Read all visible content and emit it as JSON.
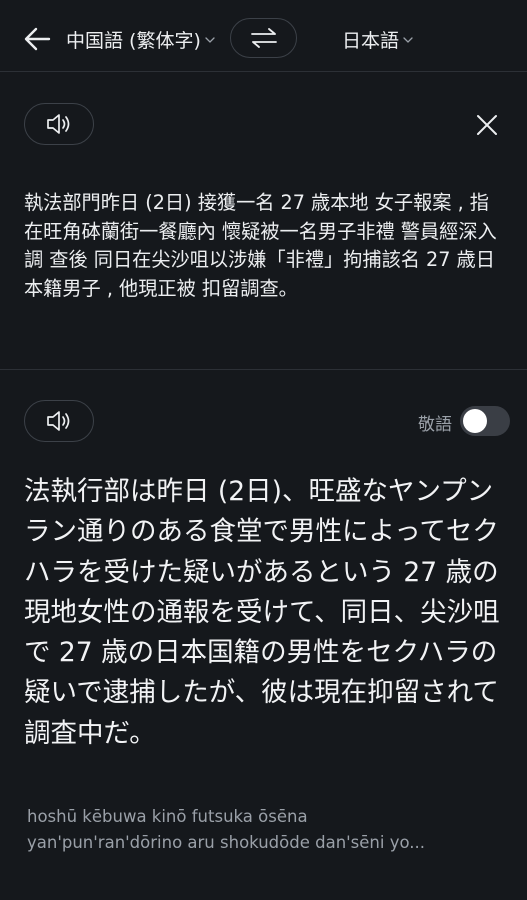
{
  "header": {
    "source_language": "中国語 (繁体字)",
    "target_language": "日本語"
  },
  "source": {
    "text": "執法部門昨日 (2日) 接獲一名 27 歳本地 女子報案 , 指在旺角砵蘭街一餐廳內 懷疑被一名男子非禮 警員經深入調 查後 同日在尖沙咀以涉嫌「非禮」拘捕該名 27 歳日本籍男子 , 他現正被 扣留調查。"
  },
  "translation": {
    "keigo_label": "敬語",
    "keigo_enabled": false,
    "text": "法執行部は昨日 (2日)、旺盛なヤンプンラン通りのある食堂で男性によってセクハラを受けた疑いがあるという 27 歳の現地女性の通報を受けて、同日、尖沙咀で 27 歳の日本国籍の男性をセクハラの疑いで逮捕したが、彼は現在抑留されて調査中だ。",
    "romanization_line1": "hoshū kēbuwa kinō futsuka ōsēna",
    "romanization_line2": "yan'pun'ran'dōrino aru shokudōde dan'sēni yo..."
  },
  "icons": {
    "back": "arrow-left-icon",
    "swap": "swap-arrows-icon",
    "speaker": "speaker-icon",
    "close": "close-icon",
    "dropdown": "chevron-down-icon"
  },
  "colors": {
    "background": "#15181c",
    "text": "#eceef0",
    "muted": "#9aa0a8",
    "border": "#3c4148"
  }
}
